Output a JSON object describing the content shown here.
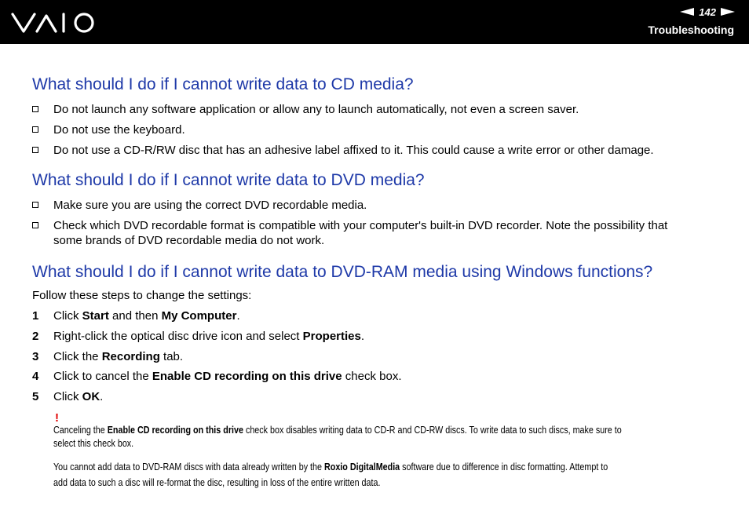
{
  "header": {
    "page_number": "142",
    "section": "Troubleshooting",
    "logo": "VAIO",
    "colors": {
      "bar": "#000000",
      "heading": "#1e39a8",
      "warning": "#e00000"
    }
  },
  "cd": {
    "heading": "What should I do if I cannot write data to CD media?",
    "items": [
      "Do not launch any software application or allow any to launch automatically, not even a screen saver.",
      "Do not use the keyboard.",
      "Do not use a CD-R/RW disc that has an adhesive label affixed to it. This could cause a write error or other damage."
    ]
  },
  "dvd": {
    "heading": "What should I do if I cannot write data to DVD media?",
    "items": [
      "Make sure you are using the correct DVD recordable media.",
      "Check which DVD recordable format is compatible with your computer's built-in DVD recorder. Note the possibility that",
      "some brands of DVD recordable media do not work."
    ]
  },
  "dvdram": {
    "heading": "What should I do if I cannot write data to DVD-RAM media using Windows functions?",
    "intro": "Follow these steps to change the settings:",
    "steps": [
      {
        "num": "1",
        "a": "Click ",
        "b": "Start",
        "c": " and then ",
        "d": "My Computer",
        "e": "."
      },
      {
        "num": "2",
        "a": "Right-click the optical disc drive icon and select ",
        "b": "Properties",
        "c": "."
      },
      {
        "num": "3",
        "a": "Click the ",
        "b": "Recording",
        "c": " tab."
      },
      {
        "num": "4",
        "a": "Click to cancel the ",
        "b": "Enable CD recording on this drive",
        "c": " check box."
      },
      {
        "num": "5",
        "a": "Click ",
        "b": "OK",
        "c": "."
      }
    ]
  },
  "notes": {
    "mark": "!",
    "note1": {
      "a": "Canceling the ",
      "b": "Enable CD recording on this drive",
      "c": " check box disables writing data to CD-R and CD-RW discs. To write data to such discs, make sure to",
      "line2": "select this check box."
    },
    "note2": {
      "a": "You cannot add data to DVD-RAM discs with data already written by the ",
      "b": "Roxio DigitalMedia",
      "c": " software due to difference in disc formatting. Attempt to",
      "line2": "add data to such a disc will re-format the disc, resulting in loss of the entire written data."
    }
  }
}
